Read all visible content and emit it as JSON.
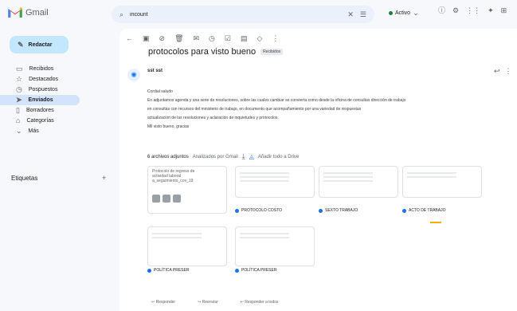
{
  "app": {
    "name": "Gmail"
  },
  "search": {
    "value": "incount"
  },
  "status": {
    "label": "Activo"
  },
  "colors": {
    "accent": "#1a73e8",
    "compose_bg": "#c2e7ff",
    "active_bg": "#d3e3fd",
    "status_green": "#188038"
  },
  "sidebar": {
    "compose_label": "Redactar",
    "items": [
      {
        "label": "Recibidos",
        "icon": "inbox-icon",
        "glyph": "▭",
        "count": ""
      },
      {
        "label": "Destacados",
        "icon": "star-icon",
        "glyph": "☆",
        "count": ""
      },
      {
        "label": "Pospuestos",
        "icon": "clock-icon",
        "glyph": "◷",
        "count": ""
      },
      {
        "label": "Enviados",
        "icon": "send-icon",
        "glyph": "➤",
        "count": "",
        "active": true
      },
      {
        "label": "Borradores",
        "icon": "draft-icon",
        "glyph": "▯",
        "count": ""
      },
      {
        "label": "Categorías",
        "icon": "label-icon",
        "glyph": "⌂",
        "count": ""
      },
      {
        "label": "Más",
        "icon": "chevron-down-icon",
        "glyph": "⌄",
        "count": ""
      }
    ],
    "labels_title": "Etiquetas"
  },
  "email": {
    "subject": "protocolos para visto bueno",
    "subject_chip": "Recibidos",
    "sender_name": "sst sst",
    "paragraphs": [
      "Cordial saludo",
      "En adjuntamos agenda y una serie de resoluciones, sobre las cuales cambiar se convierta como desde la oficina de consultas dirección de trabajo",
      "en consultas con recursos del ministerio de trabajo, en documento que acompañamiento por una variedad de respuestas",
      "actualización de las resoluciones y aclaración de inquietudes y protocolos.",
      "Mil visto bueno, gracias"
    ],
    "attachments_title": "6 archivos adjuntos",
    "attachments_sub": "Analizados por Gmail",
    "add_to_drive": "Añadir todo a Drive",
    "attachments": [
      {
        "name": "Protocolo de regreso de actividad laboral a_seguimiento_cov_19"
      },
      {
        "name": "PROTOCOLO COSTO"
      },
      {
        "name": "SEXTO TRABAJO"
      },
      {
        "name": "ACTO DE TRABAJO"
      },
      {
        "name": "POLÍTICA PRESER"
      },
      {
        "name": "POLÍTICA PRESER"
      }
    ],
    "reply_actions": [
      "Responder",
      "Reenviar",
      "Responder a todos"
    ]
  }
}
